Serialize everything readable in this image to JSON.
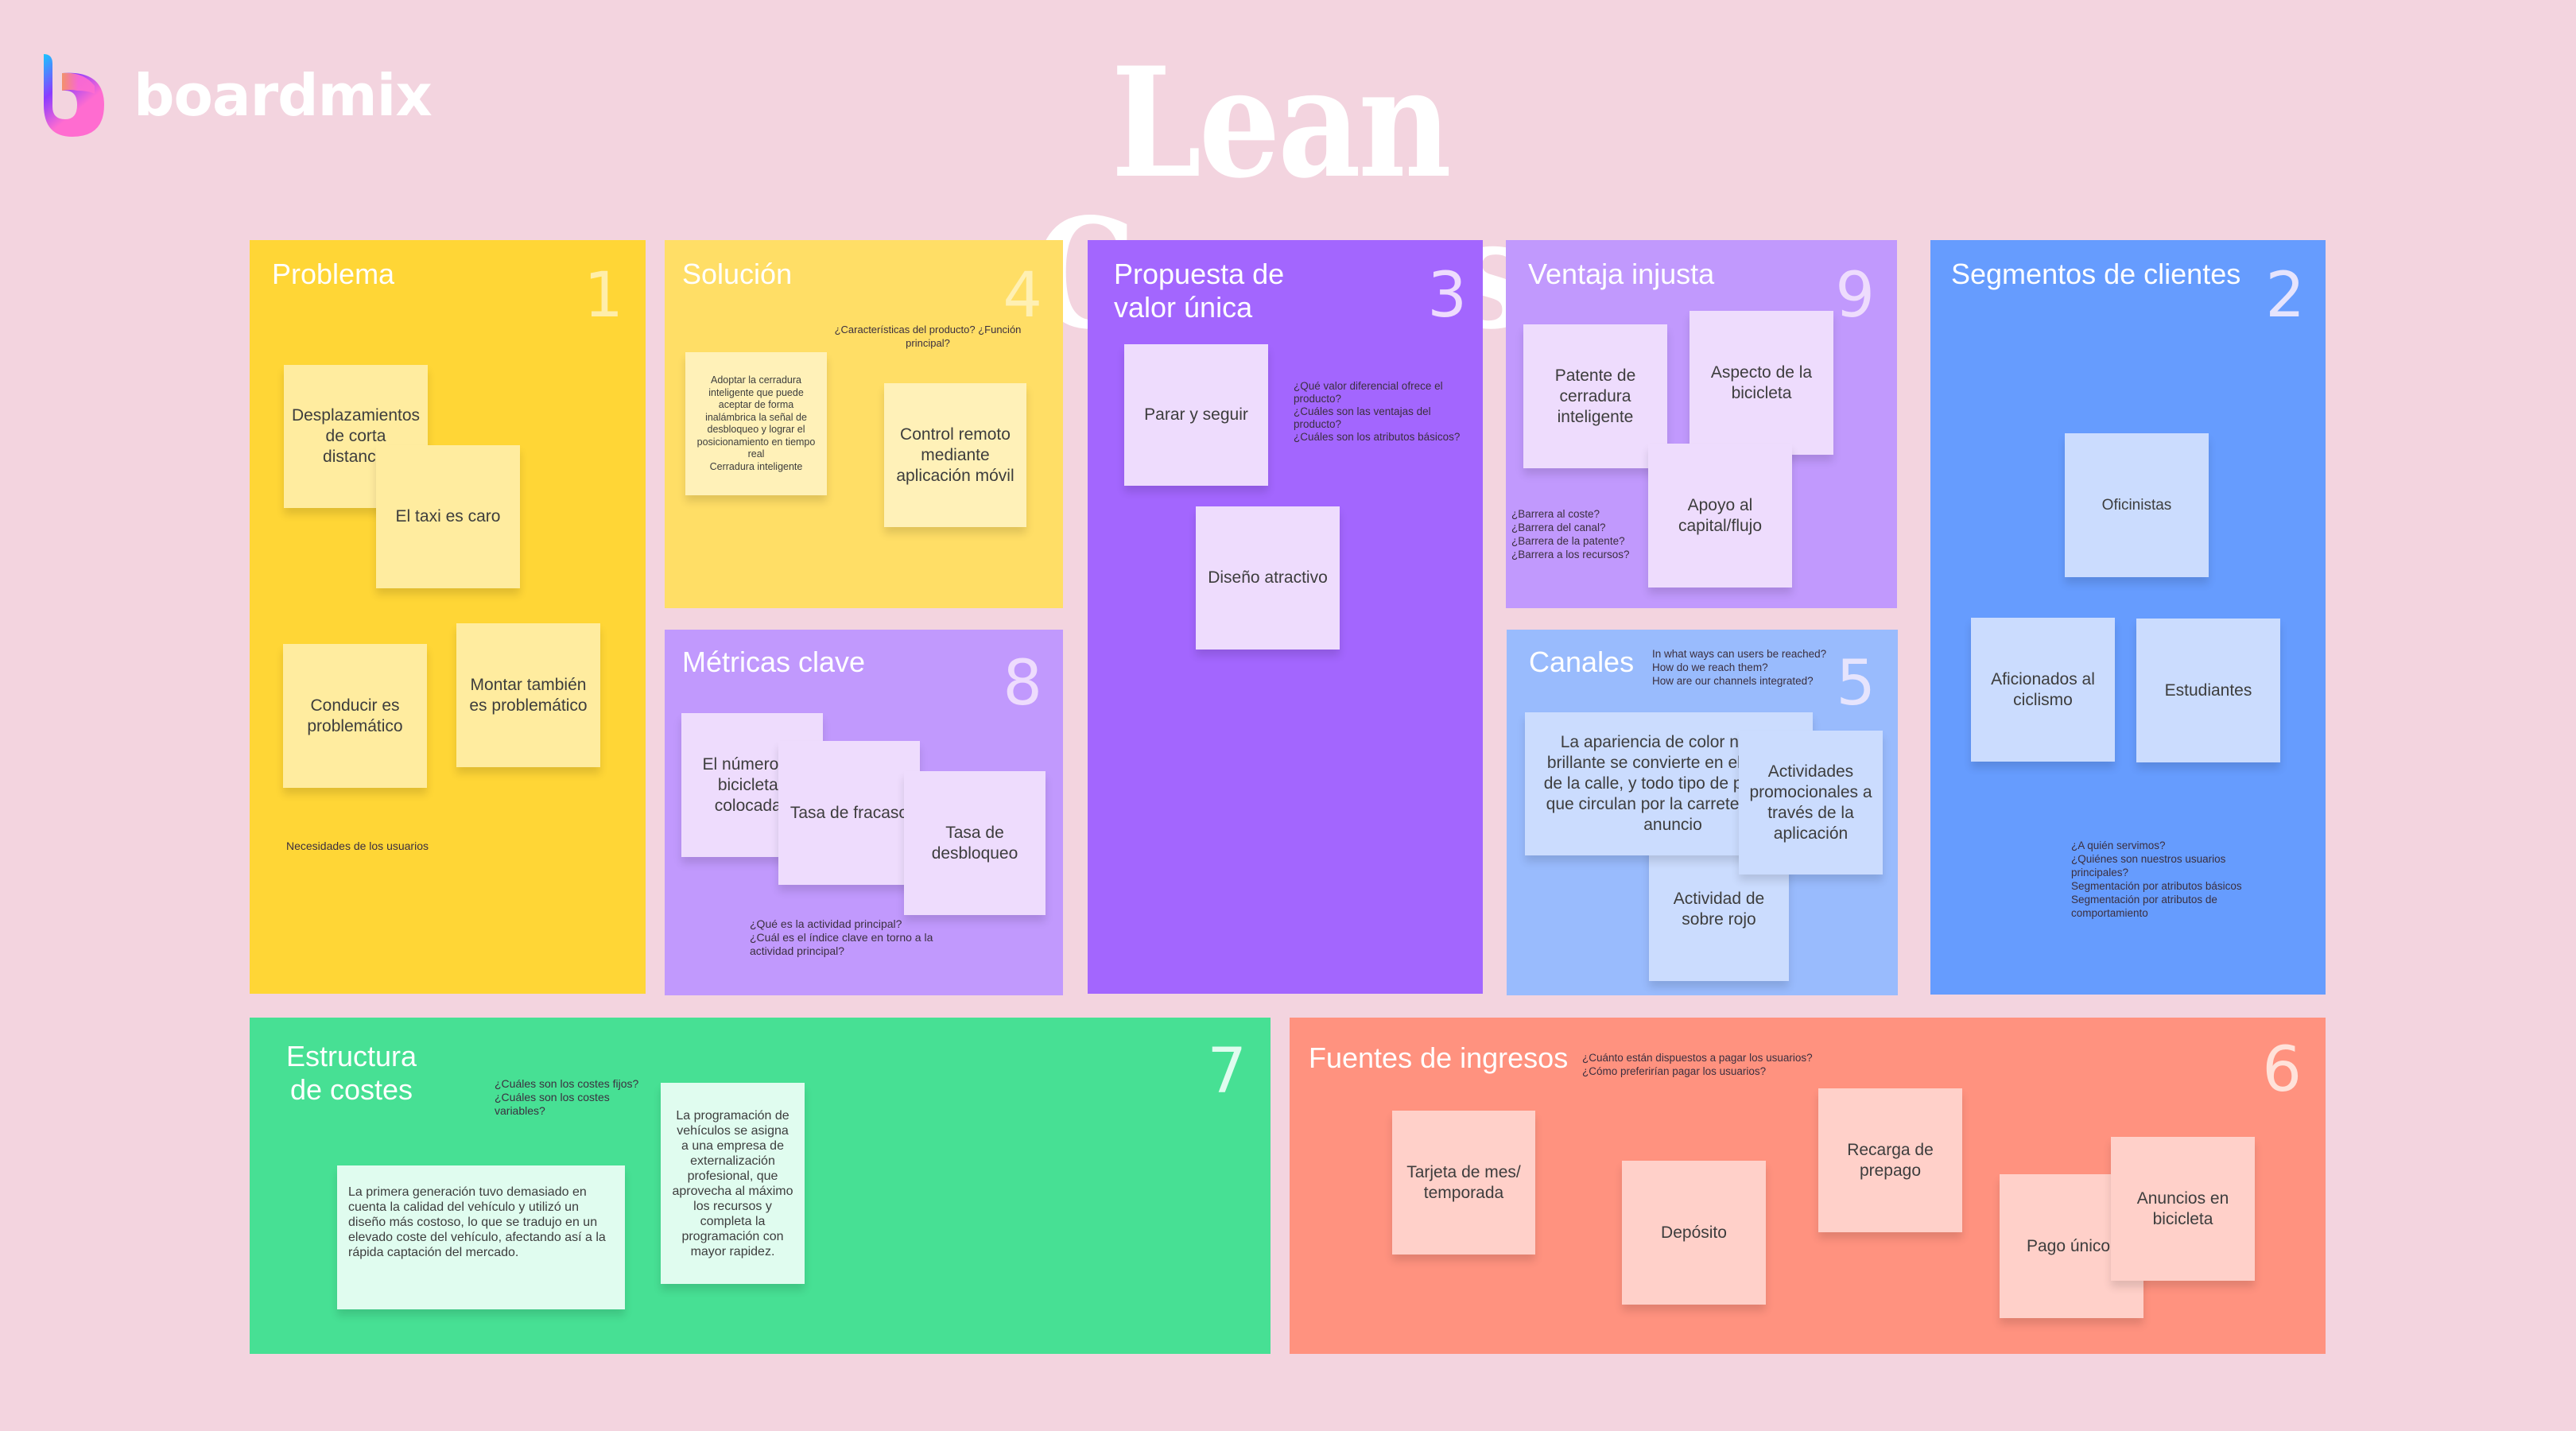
{
  "brand": {
    "name": "boardmix",
    "icon": "boardmix-logo-icon"
  },
  "title": "Lean Canvas",
  "colors": {
    "background": "#f3d4df",
    "problema": "#ffd636",
    "solucion": "#ffde66",
    "propuesta": "#a366fe",
    "ventaja": "#c199fd",
    "metricas": "#c199fd",
    "canales": "#99bbfd",
    "segmentos": "#669cfe",
    "costes": "#47e094",
    "ingresos": "#ff927f"
  },
  "panels": {
    "problema": {
      "title": "Problema",
      "number": "1",
      "hint": "Necesidades de los usuarios",
      "notes": [
        "Desplazamientos de corta distancia",
        "El taxi es caro",
        "Conducir es problemático",
        "Montar también es problemático"
      ]
    },
    "solucion": {
      "title": "Solución",
      "number": "4",
      "hint": "¿Características del producto? ¿Función principal?",
      "notes": [
        "Adoptar la cerradura inteligente que puede aceptar de forma inalámbrica la señal de desbloqueo y lograr el posicionamiento en tiempo real\nCerradura inteligente",
        "Control remoto mediante aplicación móvil"
      ]
    },
    "propuesta": {
      "title": "Propuesta de valor única",
      "number": "3",
      "hint": "¿Qué valor diferencial ofrece el producto?\n¿Cuáles son las ventajas del producto?\n¿Cuáles son los atributos básicos?",
      "notes": [
        "Parar y seguir",
        "Diseño atractivo"
      ]
    },
    "ventaja": {
      "title": "Ventaja injusta",
      "number": "9",
      "hint": "¿Barrera al coste?\n¿Barrera del canal?\n¿Barrera de la patente?\n¿Barrera a los recursos?",
      "notes": [
        "Patente de cerradura inteligente",
        "Aspecto de la bicicleta",
        "Apoyo al capital/flujo"
      ]
    },
    "segmentos": {
      "title": "Segmentos de clientes",
      "number": "2",
      "hint": "¿A quién servimos?\n¿Quiénes son nuestros usuarios principales?\nSegmentación por atributos básicos\nSegmentación por atributos de comportamiento",
      "notes": [
        "Oficinistas",
        "Aficionados al ciclismo",
        "Estudiantes"
      ]
    },
    "metricas": {
      "title": "Métricas clave",
      "number": "8",
      "hint": "¿Qué es la actividad principal?\n¿Cuál es el índice clave en torno a la actividad principal?",
      "notes": [
        "El número de bicicletas colocadas",
        "Tasa de fracaso",
        "Tasa de desbloqueo"
      ]
    },
    "canales": {
      "title": "Canales",
      "number": "5",
      "hint": "In what ways can users be reached?\nHow do we reach them?\nHow are our channels integrated?",
      "notes": [
        "La apariencia de color naranja brillante se convierte en el paisaje de la calle, y todo tipo de personas que circulan por la carretera es un anuncio",
        "Actividad de sobre rojo",
        "Actividades promocionales a través de la aplicación"
      ]
    },
    "costes": {
      "title": "Estructura de costes",
      "number": "7",
      "hint": "¿Cuáles son los costes fijos?\n¿Cuáles son los costes variables?",
      "notes": [
        "La primera generación tuvo demasiado en cuenta la calidad del vehículo y utilizó un diseño más costoso, lo que se tradujo en un elevado coste del vehículo, afectando así a la rápida captación del mercado.",
        "La programación de vehículos se asigna a una empresa de externalización profesional, que aprovecha al máximo los recursos y completa la programación con mayor rapidez."
      ]
    },
    "ingresos": {
      "title": "Fuentes de ingresos",
      "number": "6",
      "hint": "¿Cuánto están dispuestos a pagar los usuarios?\n¿Cómo preferirían pagar los usuarios?",
      "notes": [
        "Tarjeta de mes/ temporada",
        "Depósito",
        "Recarga de prepago",
        "Pago único",
        "Anuncios en bicicleta"
      ]
    }
  }
}
